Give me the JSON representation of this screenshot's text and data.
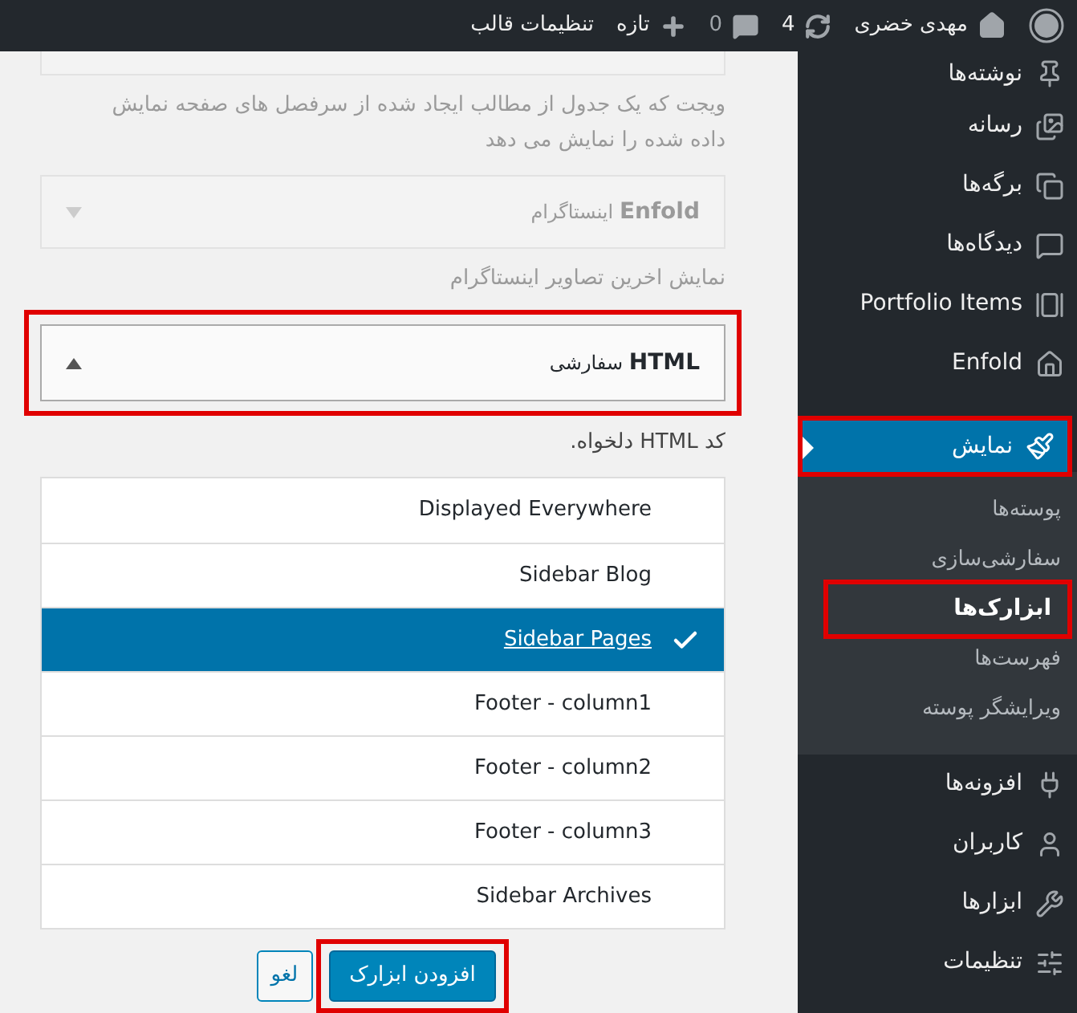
{
  "top_bar": {
    "user": "مهدی خضری",
    "updates": "4",
    "comments": "0",
    "new": "تازه",
    "customize": "تنظیمات قالب"
  },
  "widgets": [
    {
      "dimmed": true,
      "highlighted": false,
      "description": "ویجت که یک جدول از مطالب ایجاد شده از سرفصل های صفحه نمایش داده شده را نمایش می دهد"
    },
    {
      "title": "**Enfold** اینستاگرام",
      "expanded": false,
      "dimmed": true,
      "highlighted": false,
      "description": "نمایش اخرین تصاویر اینستاگرام"
    },
    {
      "title": "**HTML** سفارشی",
      "expanded": true,
      "dimmed": false,
      "highlighted": true,
      "description": "کد HTML دلخواه."
    }
  ],
  "sidebar_choices": [
    {
      "label": "Displayed Everywhere",
      "selected": false
    },
    {
      "label": "Sidebar Blog",
      "selected": false
    },
    {
      "label": "Sidebar Pages",
      "selected": true
    },
    {
      "label": "Footer - column1",
      "selected": false
    },
    {
      "label": "Footer - column2",
      "selected": false
    },
    {
      "label": "Footer - column3",
      "selected": false
    },
    {
      "label": "Sidebar Archives",
      "selected": false
    }
  ],
  "buttons": {
    "cancel": "لغو",
    "add": "افزودن ابزارک",
    "add_highlighted": true
  },
  "menu": [
    {
      "label": "نوشته‌ها",
      "selected": false,
      "highlighted": false
    },
    {
      "label": "رسانه",
      "selected": false,
      "highlighted": false
    },
    {
      "label": "برگه‌ها",
      "selected": false,
      "highlighted": false
    },
    {
      "label": "دیدگاه‌ها",
      "selected": false,
      "highlighted": false
    },
    {
      "label": "Portfolio Items",
      "selected": false,
      "highlighted": false
    },
    {
      "label": "Enfold",
      "selected": false,
      "highlighted": false
    },
    {
      "label": "نمایش",
      "selected": true,
      "highlighted": true,
      "children": [
        {
          "label": "پوسته‌ها",
          "selected": false,
          "highlighted": false
        },
        {
          "label": "سفارشی‌سازی",
          "selected": false,
          "highlighted": false
        },
        {
          "label": "ابزارک‌ها",
          "selected": true,
          "highlighted": true
        },
        {
          "label": "فهرست‌ها",
          "selected": false,
          "highlighted": false
        },
        {
          "label": "ویرایشگر پوسته",
          "selected": false,
          "highlighted": false
        }
      ]
    },
    {
      "label": "افزونه‌ها",
      "selected": false,
      "highlighted": false
    },
    {
      "label": "کاربران",
      "selected": false,
      "highlighted": false
    },
    {
      "label": "ابزارها",
      "selected": false,
      "highlighted": false
    },
    {
      "label": "تنظیمات",
      "selected": false,
      "highlighted": false
    }
  ]
}
